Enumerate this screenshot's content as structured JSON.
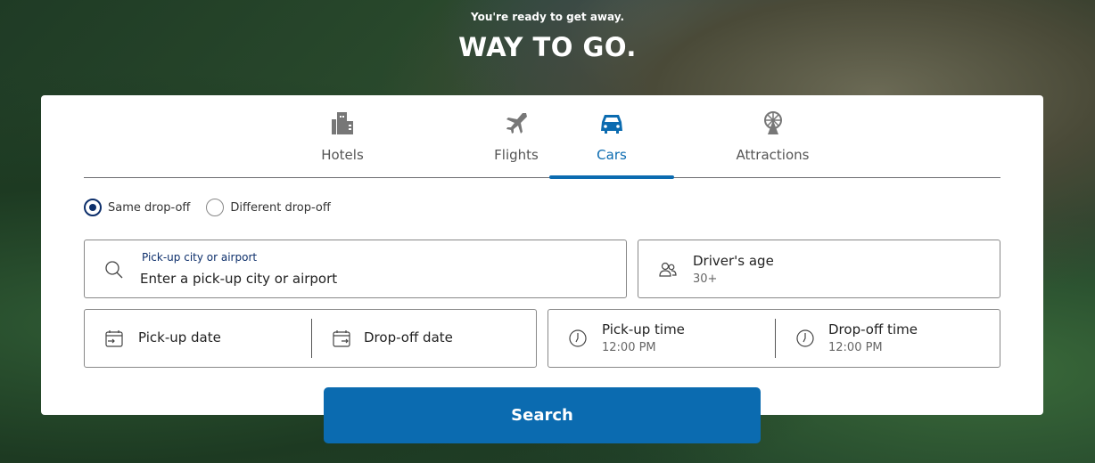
{
  "hero": {
    "subtitle": "You're ready to get away.",
    "title": "WAY TO GO."
  },
  "tabs": [
    {
      "label": "Hotels",
      "icon": "hotel-icon"
    },
    {
      "label": "Flights",
      "icon": "airplane-icon"
    },
    {
      "label": "Cars",
      "icon": "car-icon",
      "active": true
    },
    {
      "label": "Attractions",
      "icon": "ferris-wheel-icon"
    }
  ],
  "radios": {
    "same": "Same drop-off",
    "different": "Different drop-off",
    "selected": "Same drop-off"
  },
  "pickup": {
    "label": "Pick-up city or airport",
    "placeholder": "Enter a pick-up city or airport"
  },
  "driver": {
    "label": "Driver's age",
    "value": "30+"
  },
  "dates": {
    "pickup": "Pick-up date",
    "dropoff": "Drop-off date"
  },
  "times": {
    "pickup_label": "Pick-up time",
    "pickup_value": "12:00 PM",
    "dropoff_label": "Drop-off time",
    "dropoff_value": "12:00 PM"
  },
  "search_label": "Search",
  "colors": {
    "accent": "#0b6bb0",
    "radio": "#0d2f6b"
  }
}
